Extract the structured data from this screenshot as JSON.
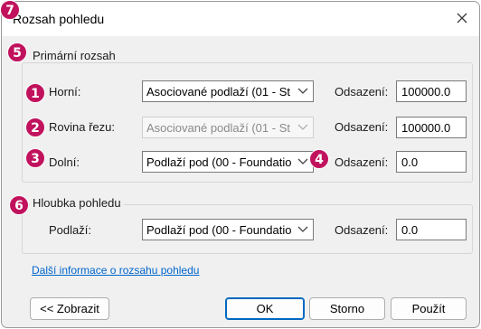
{
  "dialog": {
    "title": "Rozsah pohledu"
  },
  "primary_range": {
    "group_label": "Primární rozsah",
    "rows": [
      {
        "label": "Horní:",
        "combo_value": "Asociované podlaží (01 - St",
        "offset_label": "Odsazení:",
        "offset_value": "100000.0",
        "enabled": true
      },
      {
        "label": "Rovina řezu:",
        "combo_value": "Asociované podlaží (01 - St",
        "offset_label": "Odsazení:",
        "offset_value": "100000.0",
        "enabled": false
      },
      {
        "label": "Dolní:",
        "combo_value": "Podlaží pod (00 - Foundatio",
        "offset_label": "Odsazení:",
        "offset_value": "0.0",
        "enabled": true
      }
    ]
  },
  "view_depth": {
    "group_label": "Hloubka pohledu",
    "row": {
      "label": "Podlaží:",
      "combo_value": "Podlaží pod (00 - Foundatio",
      "offset_label": "Odsazení:",
      "offset_value": "0.0"
    }
  },
  "more_info_link": "Další informace o rozsahu pohledu",
  "buttons": {
    "show": "<< Zobrazit",
    "ok": "OK",
    "cancel": "Storno",
    "apply": "Použít"
  },
  "callouts": [
    "1",
    "2",
    "3",
    "4",
    "5",
    "6",
    "7"
  ],
  "colors": {
    "callout": "#c0125d",
    "link": "#0066cc",
    "default_button_border": "#0067c0"
  }
}
